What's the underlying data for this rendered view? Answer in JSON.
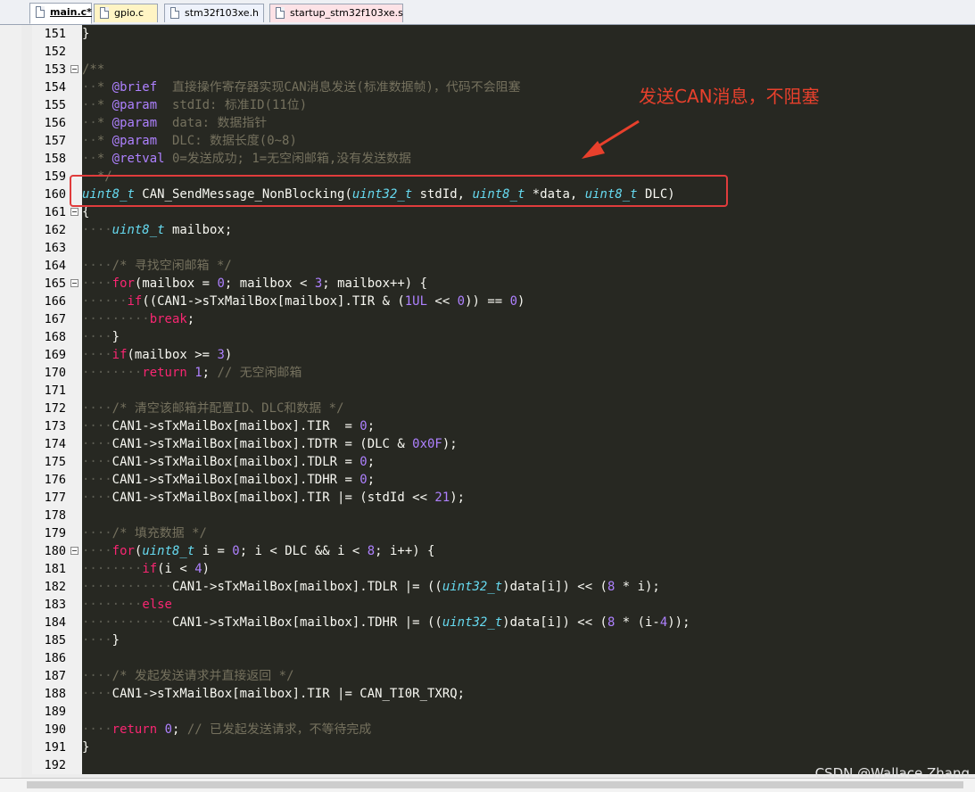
{
  "tabs": [
    {
      "label": "main.c*",
      "active": true
    },
    {
      "label": "gpio.c",
      "active": false
    },
    {
      "label": "stm32f103xe.h",
      "active": false
    },
    {
      "label": "startup_stm32f103xe.s",
      "active": false
    }
  ],
  "colors": {
    "editor_background": "#272822",
    "comment": "#75715e",
    "keyword": "#f92672",
    "type": "#66d9ef",
    "number": "#ae81ff",
    "annotation": "#e8402c"
  },
  "annotation": {
    "text": "发送CAN消息，不阻塞"
  },
  "watermark": "CSDN @Wallace Zhang",
  "lines": [
    {
      "n": "151",
      "fold": false,
      "tokens": [
        [
          "t",
          "}"
        ]
      ]
    },
    {
      "n": "152",
      "fold": false,
      "tokens": []
    },
    {
      "n": "153",
      "fold": true,
      "tokens": [
        [
          "c",
          "/**"
        ]
      ]
    },
    {
      "n": "154",
      "fold": false,
      "tokens": [
        [
          "w",
          "··"
        ],
        [
          "c",
          "* "
        ],
        [
          "g",
          "@brief"
        ],
        [
          "c",
          "  直接操作寄存器实现CAN消息发送(标准数据帧)，代码不会阻塞"
        ]
      ]
    },
    {
      "n": "155",
      "fold": false,
      "tokens": [
        [
          "w",
          "··"
        ],
        [
          "c",
          "* "
        ],
        [
          "g",
          "@param"
        ],
        [
          "c",
          "  stdId: 标准ID(11位)"
        ]
      ]
    },
    {
      "n": "156",
      "fold": false,
      "tokens": [
        [
          "w",
          "··"
        ],
        [
          "c",
          "* "
        ],
        [
          "g",
          "@param"
        ],
        [
          "c",
          "  data: 数据指针"
        ]
      ]
    },
    {
      "n": "157",
      "fold": false,
      "tokens": [
        [
          "w",
          "··"
        ],
        [
          "c",
          "* "
        ],
        [
          "g",
          "@param"
        ],
        [
          "c",
          "  DLC: 数据长度(0~8)"
        ]
      ]
    },
    {
      "n": "158",
      "fold": false,
      "tokens": [
        [
          "w",
          "··"
        ],
        [
          "c",
          "* "
        ],
        [
          "g",
          "@retval"
        ],
        [
          "c",
          " 0=发送成功; 1=无空闲邮箱,没有发送数据"
        ]
      ]
    },
    {
      "n": "159",
      "fold": false,
      "tokens": [
        [
          "w",
          "··"
        ],
        [
          "c",
          "*/"
        ]
      ]
    },
    {
      "n": "160",
      "fold": false,
      "tokens": [
        [
          "y",
          "uint8_t"
        ],
        [
          "t",
          " CAN_SendMessage_NonBlocking("
        ],
        [
          "y",
          "uint32_t"
        ],
        [
          "t",
          " stdId, "
        ],
        [
          "y",
          "uint8_t"
        ],
        [
          "t",
          " *data, "
        ],
        [
          "y",
          "uint8_t"
        ],
        [
          "t",
          " DLC)"
        ]
      ]
    },
    {
      "n": "161",
      "fold": true,
      "tokens": [
        [
          "t",
          "{"
        ]
      ]
    },
    {
      "n": "162",
      "fold": false,
      "tokens": [
        [
          "w",
          "····"
        ],
        [
          "y",
          "uint8_t"
        ],
        [
          "t",
          " mailbox;"
        ]
      ]
    },
    {
      "n": "163",
      "fold": false,
      "tokens": []
    },
    {
      "n": "164",
      "fold": false,
      "tokens": [
        [
          "w",
          "····"
        ],
        [
          "c",
          "/* 寻找空闲邮箱 */"
        ]
      ]
    },
    {
      "n": "165",
      "fold": true,
      "tokens": [
        [
          "w",
          "····"
        ],
        [
          "k",
          "for"
        ],
        [
          "t",
          "(mailbox = "
        ],
        [
          "m",
          "0"
        ],
        [
          "t",
          "; mailbox < "
        ],
        [
          "m",
          "3"
        ],
        [
          "t",
          "; mailbox++) {"
        ]
      ]
    },
    {
      "n": "166",
      "fold": false,
      "tokens": [
        [
          "w",
          "······"
        ],
        [
          "k",
          "if"
        ],
        [
          "t",
          "((CAN1->sTxMailBox[mailbox].TIR & ("
        ],
        [
          "m",
          "1UL"
        ],
        [
          "t",
          " << "
        ],
        [
          "m",
          "0"
        ],
        [
          "t",
          ")) == "
        ],
        [
          "m",
          "0"
        ],
        [
          "t",
          ")"
        ]
      ]
    },
    {
      "n": "167",
      "fold": false,
      "tokens": [
        [
          "w",
          "·········"
        ],
        [
          "k",
          "break"
        ],
        [
          "t",
          ";"
        ]
      ]
    },
    {
      "n": "168",
      "fold": false,
      "tokens": [
        [
          "w",
          "····"
        ],
        [
          "t",
          "}"
        ]
      ]
    },
    {
      "n": "169",
      "fold": false,
      "tokens": [
        [
          "w",
          "····"
        ],
        [
          "k",
          "if"
        ],
        [
          "t",
          "(mailbox >= "
        ],
        [
          "m",
          "3"
        ],
        [
          "t",
          ")"
        ]
      ]
    },
    {
      "n": "170",
      "fold": false,
      "tokens": [
        [
          "w",
          "········"
        ],
        [
          "k",
          "return"
        ],
        [
          "t",
          " "
        ],
        [
          "m",
          "1"
        ],
        [
          "t",
          "; "
        ],
        [
          "c",
          "// 无空闲邮箱"
        ]
      ]
    },
    {
      "n": "171",
      "fold": false,
      "tokens": []
    },
    {
      "n": "172",
      "fold": false,
      "tokens": [
        [
          "w",
          "····"
        ],
        [
          "c",
          "/* 清空该邮箱并配置ID、DLC和数据 */"
        ]
      ]
    },
    {
      "n": "173",
      "fold": false,
      "tokens": [
        [
          "w",
          "····"
        ],
        [
          "t",
          "CAN1->sTxMailBox[mailbox].TIR  = "
        ],
        [
          "m",
          "0"
        ],
        [
          "t",
          ";"
        ]
      ]
    },
    {
      "n": "174",
      "fold": false,
      "tokens": [
        [
          "w",
          "····"
        ],
        [
          "t",
          "CAN1->sTxMailBox[mailbox].TDTR = (DLC & "
        ],
        [
          "m",
          "0x0F"
        ],
        [
          "t",
          ");"
        ]
      ]
    },
    {
      "n": "175",
      "fold": false,
      "tokens": [
        [
          "w",
          "····"
        ],
        [
          "t",
          "CAN1->sTxMailBox[mailbox].TDLR = "
        ],
        [
          "m",
          "0"
        ],
        [
          "t",
          ";"
        ]
      ]
    },
    {
      "n": "176",
      "fold": false,
      "tokens": [
        [
          "w",
          "····"
        ],
        [
          "t",
          "CAN1->sTxMailBox[mailbox].TDHR = "
        ],
        [
          "m",
          "0"
        ],
        [
          "t",
          ";"
        ]
      ]
    },
    {
      "n": "177",
      "fold": false,
      "tokens": [
        [
          "w",
          "····"
        ],
        [
          "t",
          "CAN1->sTxMailBox[mailbox].TIR |= (stdId << "
        ],
        [
          "m",
          "21"
        ],
        [
          "t",
          ");"
        ]
      ]
    },
    {
      "n": "178",
      "fold": false,
      "tokens": []
    },
    {
      "n": "179",
      "fold": false,
      "tokens": [
        [
          "w",
          "····"
        ],
        [
          "c",
          "/* 填充数据 */"
        ]
      ]
    },
    {
      "n": "180",
      "fold": true,
      "tokens": [
        [
          "w",
          "····"
        ],
        [
          "k",
          "for"
        ],
        [
          "t",
          "("
        ],
        [
          "y",
          "uint8_t"
        ],
        [
          "t",
          " i = "
        ],
        [
          "m",
          "0"
        ],
        [
          "t",
          "; i < DLC && i < "
        ],
        [
          "m",
          "8"
        ],
        [
          "t",
          "; i++) {"
        ]
      ]
    },
    {
      "n": "181",
      "fold": false,
      "tokens": [
        [
          "w",
          "········"
        ],
        [
          "k",
          "if"
        ],
        [
          "t",
          "(i < "
        ],
        [
          "m",
          "4"
        ],
        [
          "t",
          ")"
        ]
      ]
    },
    {
      "n": "182",
      "fold": false,
      "tokens": [
        [
          "w",
          "············"
        ],
        [
          "t",
          "CAN1->sTxMailBox[mailbox].TDLR |= (("
        ],
        [
          "y",
          "uint32_t"
        ],
        [
          "t",
          ")data[i]) << ("
        ],
        [
          "m",
          "8"
        ],
        [
          "t",
          " * i);"
        ]
      ]
    },
    {
      "n": "183",
      "fold": false,
      "tokens": [
        [
          "w",
          "········"
        ],
        [
          "k",
          "else"
        ]
      ]
    },
    {
      "n": "184",
      "fold": false,
      "tokens": [
        [
          "w",
          "············"
        ],
        [
          "t",
          "CAN1->sTxMailBox[mailbox].TDHR |= (("
        ],
        [
          "y",
          "uint32_t"
        ],
        [
          "t",
          ")data[i]) << ("
        ],
        [
          "m",
          "8"
        ],
        [
          "t",
          " * (i-"
        ],
        [
          "m",
          "4"
        ],
        [
          "t",
          "));"
        ]
      ]
    },
    {
      "n": "185",
      "fold": false,
      "tokens": [
        [
          "w",
          "····"
        ],
        [
          "t",
          "}"
        ]
      ]
    },
    {
      "n": "186",
      "fold": false,
      "tokens": []
    },
    {
      "n": "187",
      "fold": false,
      "tokens": [
        [
          "w",
          "····"
        ],
        [
          "c",
          "/* 发起发送请求并直接返回 */"
        ]
      ]
    },
    {
      "n": "188",
      "fold": false,
      "tokens": [
        [
          "w",
          "····"
        ],
        [
          "t",
          "CAN1->sTxMailBox[mailbox].TIR |= CAN_TI0R_TXRQ;"
        ]
      ]
    },
    {
      "n": "189",
      "fold": false,
      "tokens": []
    },
    {
      "n": "190",
      "fold": false,
      "tokens": [
        [
          "w",
          "····"
        ],
        [
          "k",
          "return"
        ],
        [
          "t",
          " "
        ],
        [
          "m",
          "0"
        ],
        [
          "t",
          "; "
        ],
        [
          "c",
          "// 已发起发送请求，不等待完成"
        ]
      ]
    },
    {
      "n": "191",
      "fold": false,
      "tokens": [
        [
          "t",
          "}"
        ]
      ]
    },
    {
      "n": "192",
      "fold": false,
      "tokens": []
    }
  ]
}
